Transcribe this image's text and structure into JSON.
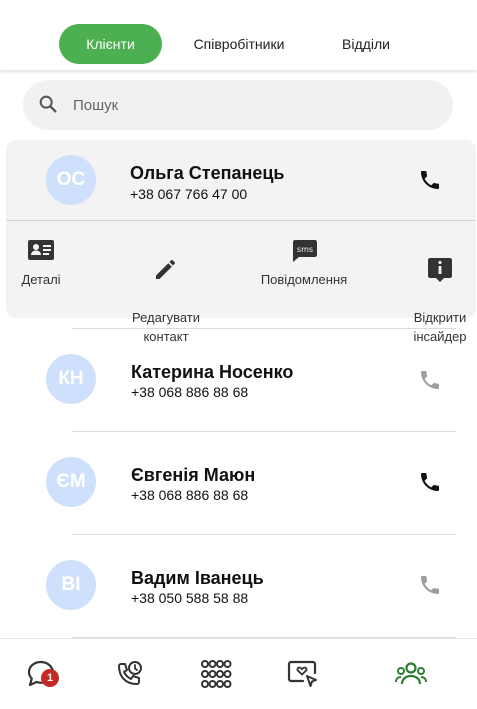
{
  "tabs": [
    {
      "label": "Клієнти",
      "active": true
    },
    {
      "label": "Співробітники",
      "active": false
    },
    {
      "label": "Відділи",
      "active": false
    }
  ],
  "search": {
    "placeholder": "Пошук",
    "icon": "search-icon"
  },
  "contacts": [
    {
      "initials": "ОС",
      "name": "Ольга Степанець",
      "phone": "+38 067 766 47 00",
      "call_active": true,
      "expanded": true
    },
    {
      "initials": "КН",
      "name": "Катерина Носенко",
      "phone": "+38 068 886 88 68",
      "call_active": false
    },
    {
      "initials": "ЄМ",
      "name": "Євгенія Маюн",
      "phone": "+38 068 886 88 68",
      "call_active": true
    },
    {
      "initials": "ВІ",
      "name": "Вадим Іванець",
      "phone": "+38 050 588 58 88",
      "call_active": false
    }
  ],
  "actions": [
    {
      "label": "Деталі",
      "icon": "details-card-icon"
    },
    {
      "label": "Редагувати\nконтакт",
      "icon": "edit-pencil-icon"
    },
    {
      "label": "Повідомлення",
      "icon": "sms-message-icon"
    },
    {
      "label": "Відкрити\nінсайдер",
      "icon": "info-icon"
    }
  ],
  "bottom_nav": {
    "chat_badge": "1",
    "items": [
      "chat-icon",
      "call-history-icon",
      "apps-grid-icon",
      "feedback-icon",
      "contacts-icon"
    ]
  },
  "colors": {
    "accent": "#4caf50",
    "avatar_bg": "#cfe0fc",
    "badge": "#c62828"
  }
}
